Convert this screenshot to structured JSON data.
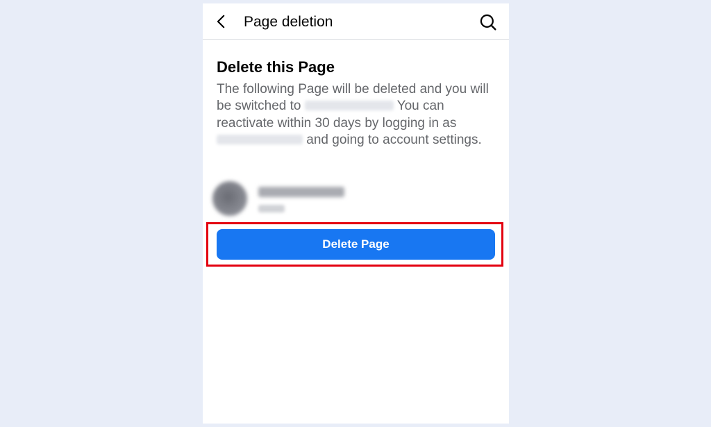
{
  "header": {
    "title": "Page deletion",
    "back_icon": "chevron-left-icon",
    "search_icon": "search-icon"
  },
  "content": {
    "section_title": "Delete this Page",
    "description": {
      "part1": "The following Page will be deleted and you will be switched to",
      "part2": "You can reactivate within 30 days by logging in as",
      "part3": "and going to account settings."
    }
  },
  "delete_button": {
    "label": "Delete Page"
  },
  "colors": {
    "primary_button": "#1877f2",
    "highlight_border": "#e3000f",
    "background": "#e8edf8"
  }
}
